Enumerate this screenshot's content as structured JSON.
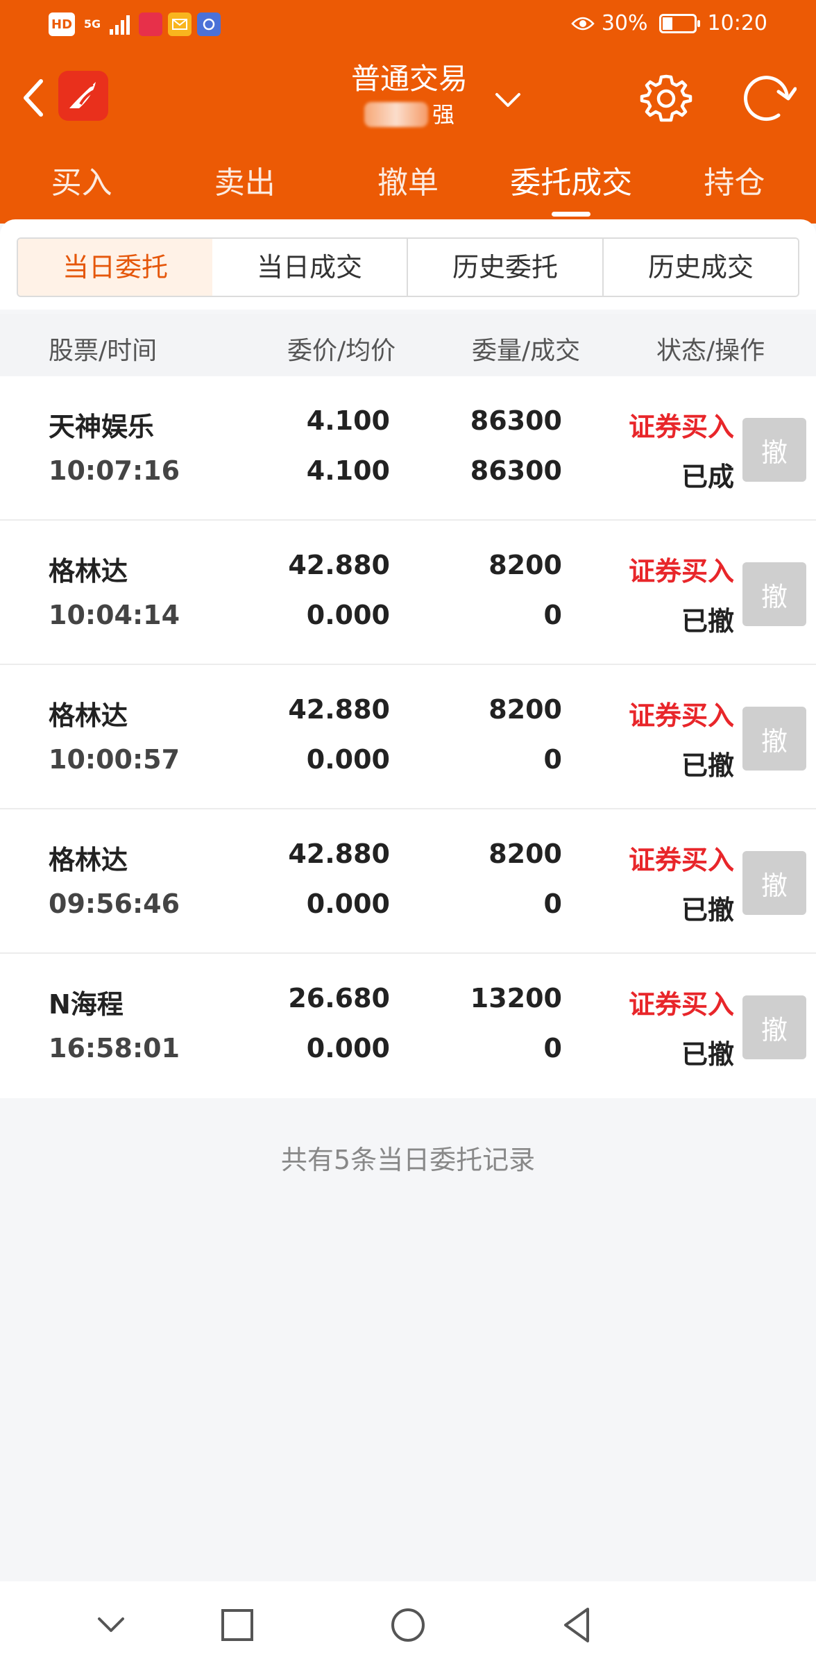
{
  "status_bar": {
    "left_badges": [
      "HD",
      "5G"
    ],
    "battery": "30%",
    "battery_level": 0.3,
    "time": "10:20"
  },
  "header": {
    "title": "普通交易",
    "account_suffix": "强",
    "icons": [
      "back-icon",
      "app-logo-icon",
      "chevron-down-icon",
      "gear-icon",
      "refresh-icon"
    ],
    "brand_color": "#ec5a05"
  },
  "main_tabs": [
    {
      "label": "买入"
    },
    {
      "label": "卖出"
    },
    {
      "label": "撤单"
    },
    {
      "label": "委托成交"
    },
    {
      "label": "持仓"
    }
  ],
  "sub_tabs": [
    {
      "label": "当日委托"
    },
    {
      "label": "当日成交"
    },
    {
      "label": "历史委托"
    },
    {
      "label": "历史成交"
    }
  ],
  "columns": [
    "股票/时间",
    "委价/均价",
    "委量/成交",
    "状态/操作"
  ],
  "orders": [
    {
      "name": "天神娱乐",
      "time": "10:07:16",
      "price": "4.100",
      "avg": "4.100",
      "qty": "86300",
      "filled": "86300",
      "side": "证券买入",
      "state": "已成",
      "action": "撤"
    },
    {
      "name": "格林达",
      "time": "10:04:14",
      "price": "42.880",
      "avg": "0.000",
      "qty": "8200",
      "filled": "0",
      "side": "证券买入",
      "state": "已撤",
      "action": "撤"
    },
    {
      "name": "格林达",
      "time": "10:00:57",
      "price": "42.880",
      "avg": "0.000",
      "qty": "8200",
      "filled": "0",
      "side": "证券买入",
      "state": "已撤",
      "action": "撤"
    },
    {
      "name": "格林达",
      "time": "09:56:46",
      "price": "42.880",
      "avg": "0.000",
      "qty": "8200",
      "filled": "0",
      "side": "证券买入",
      "state": "已撤",
      "action": "撤"
    },
    {
      "name": "N海程",
      "time": "16:58:01",
      "price": "26.680",
      "avg": "0.000",
      "qty": "13200",
      "filled": "0",
      "side": "证券买入",
      "state": "已撤",
      "action": "撤"
    }
  ],
  "footer": "共有5条当日委托记录",
  "colors": {
    "buy_red": "#e8262a",
    "active_tab": "#e5570b",
    "cancel_disabled": "#cfcfcf"
  }
}
